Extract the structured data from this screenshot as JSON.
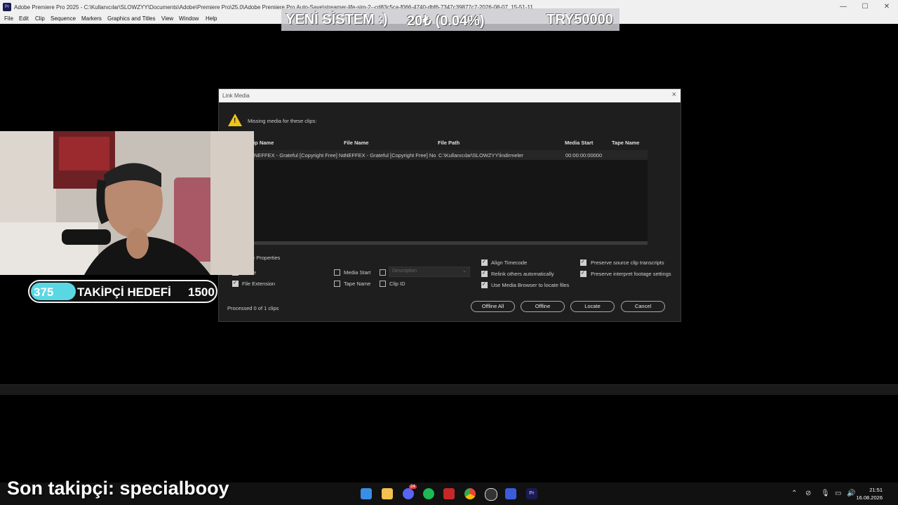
{
  "window": {
    "title": "Adobe Premiere Pro 2025 - C:\\Kullanıcılar\\SLOWZYY\\Documents\\Adobe\\Premiere Pro\\25.0\\Adobe Premiere Pro Auto-Save\\streamer-life-sim-2--cd83c5ca-f066-4740-dbf6-7347c39877c7-2026-08-07_15-51-11",
    "app_icon": "Pr"
  },
  "menu": [
    "File",
    "Edit",
    "Clip",
    "Sequence",
    "Markers",
    "Graphics and Titles",
    "View",
    "Window",
    "Help"
  ],
  "donation_bar": {
    "label": "YENİ SİSTEM :)",
    "amount": "20₺ (0.04%)",
    "goal": "TRY50000"
  },
  "dialog": {
    "title": "Link Media",
    "close": "×",
    "warning_text": "Missing media for these clips:",
    "columns": [
      "lip Name",
      "File Name",
      "File Path",
      "Media Start",
      "Tape Name"
    ],
    "rows": [
      {
        "clip_name": "NEFFEX - Grateful [Copyright Free] No",
        "file_name": "NEFFEX - Grateful [Copyright Free] No",
        "file_path": "C:\\Kullanıcılar\\SLOWZYY\\İndirmeler",
        "media_start": "00:00:00:00000",
        "tape_name": ""
      }
    ],
    "match_section_label": "e Properties",
    "match_options": [
      {
        "label": "Name",
        "checked": true
      },
      {
        "label": "File Extension",
        "checked": true
      },
      {
        "label": "Media Start",
        "checked": false
      },
      {
        "label": "Tape Name",
        "checked": false
      },
      {
        "label": "Description",
        "checked": false
      },
      {
        "label": "Clip ID",
        "checked": false
      }
    ],
    "description_placeholder": "Description",
    "right_options": [
      {
        "label": "Align Timecode",
        "checked": true
      },
      {
        "label": "Relink others automatically",
        "checked": true
      },
      {
        "label": "Use Media Browser to locate files",
        "checked": true
      },
      {
        "label": "Preserve source clip transcripts",
        "checked": true
      },
      {
        "label": "Preserve interpret footage settings",
        "checked": true
      }
    ],
    "status": "Processed 0 of 1 clips",
    "buttons": [
      "Offline All",
      "Offline",
      "Locate",
      "Cancel"
    ]
  },
  "follower_goal": {
    "current": "375",
    "label": "TAKİPÇİ HEDEFİ",
    "target": "1500"
  },
  "last_follower": "Son takipçi: specialbooy",
  "taskbar": {
    "icons": [
      "windows-start-icon",
      "file-explorer-icon",
      "discord-icon",
      "spotify-icon",
      "steam-like-icon",
      "chrome-icon",
      "obs-icon",
      "app-icon",
      "premiere-icon"
    ],
    "discord_badge": "24",
    "time": "21:51",
    "date": "16.08.2026"
  },
  "colors": {
    "accent_goal": "#59d8e4",
    "warning": "#f0c419",
    "dialog_bg": "#1e1e1e"
  }
}
